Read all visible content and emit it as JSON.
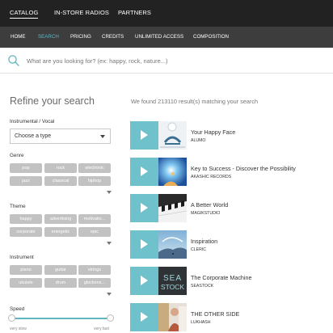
{
  "top_nav": [
    "CATALOG",
    "IN-STORE RADIOS",
    "PARTNERS"
  ],
  "sub_nav": [
    "HOME",
    "SEARCH",
    "PRICING",
    "CREDITS",
    "UNLIMITED ACCESS",
    "COMPOSITION"
  ],
  "search": {
    "placeholder": "What are you looking for? (ex: happy, rock, nature...)",
    "value": ""
  },
  "sidebar": {
    "title": "Refine your search",
    "instrumental_vocal": {
      "label": "Instrumental / Vocal",
      "selected": "Choose a type"
    },
    "genre": {
      "label": "Genre",
      "tags": [
        "pop",
        "rock",
        "electronic",
        "jazz",
        "classical",
        "hiphop"
      ]
    },
    "theme": {
      "label": "Theme",
      "tags": [
        "happy",
        "advertising",
        "motivatio...",
        "corporate",
        "energetic",
        "epic"
      ]
    },
    "instrument": {
      "label": "Instrument",
      "tags": [
        "piano",
        "guitar",
        "strings",
        "ukulele",
        "drum",
        "glockens..."
      ]
    },
    "speed": {
      "label": "Speed",
      "min_label": "very slow",
      "max_label": "very fast"
    }
  },
  "results": {
    "count_text": "We found 213110 result(s) matching your search",
    "tracks": [
      {
        "title": "Your Happy Face",
        "artist": "ALUMO"
      },
      {
        "title": "Key to Success - Discover the Possibility",
        "artist": "AKASHIC RECORDS"
      },
      {
        "title": "A Better World",
        "artist": "MAGIKSTUDIO"
      },
      {
        "title": "Inspiration",
        "artist": "CLERIC"
      },
      {
        "title": "The Corporate Machine",
        "artist": "SEASTOCK"
      },
      {
        "title": "THE OTHER SIDE",
        "artist": "LUKHASH"
      }
    ],
    "cover_texts": {
      "seastock_line1": "SEA",
      "seastock_line2": "STOCK"
    }
  },
  "colors": {
    "accent": "#5fb7c2",
    "play_bg": "#6fc2cc",
    "tag_bg": "#c2c2c2",
    "topbar": "#222222",
    "subnav": "#3d3d3d"
  }
}
